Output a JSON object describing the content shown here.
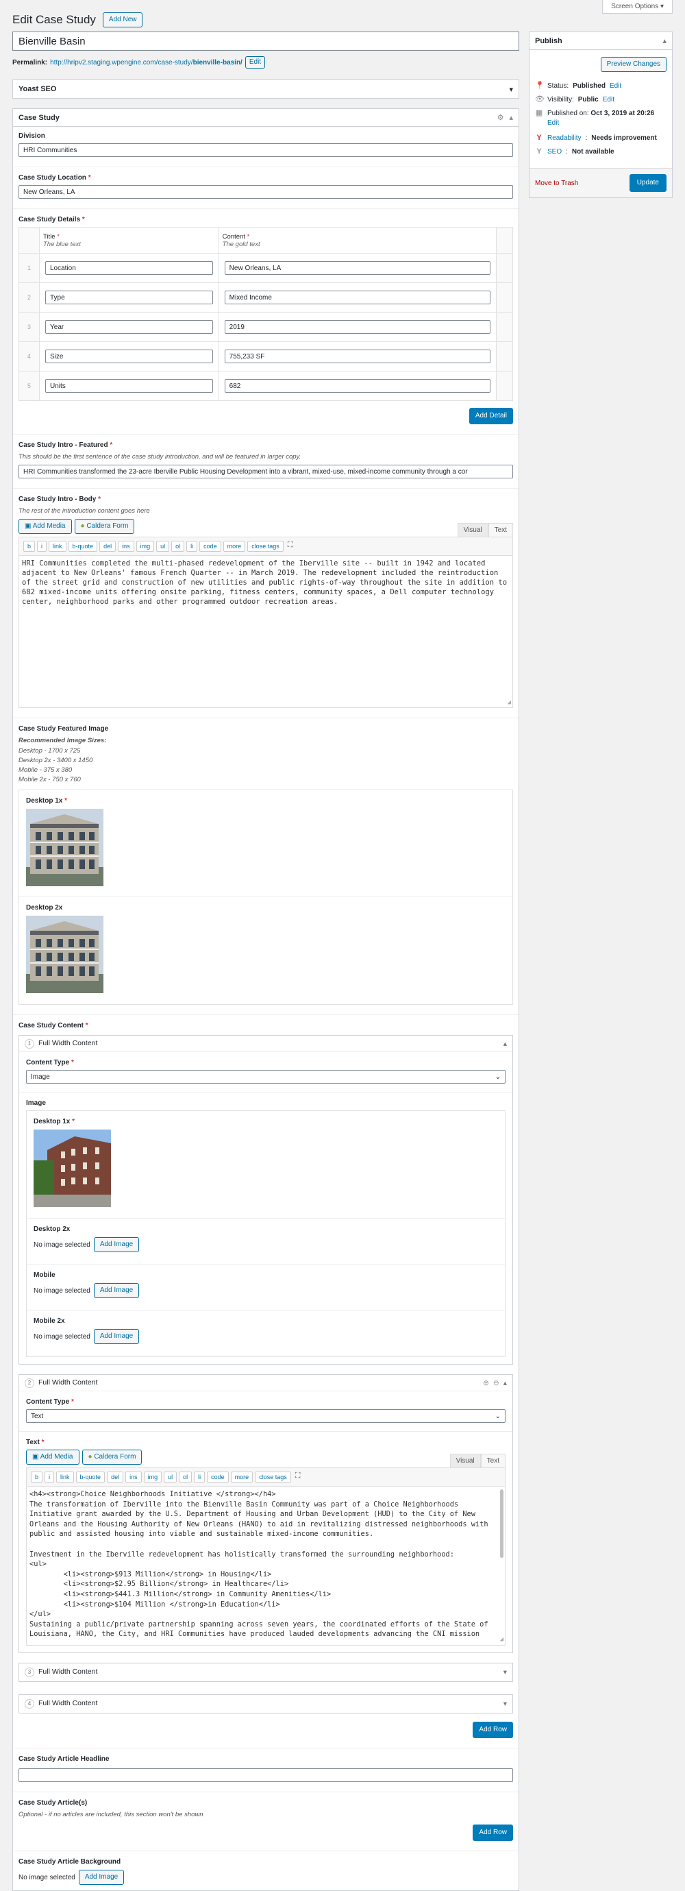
{
  "screen_options": "Screen Options",
  "header": {
    "title": "Edit Case Study",
    "add_new": "Add New"
  },
  "post": {
    "title": "Bienville Basin",
    "permalink_label": "Permalink:",
    "permalink_base": "http://hripv2.staging.wpengine.com/case-study/",
    "permalink_slug": "bienville-basin/",
    "edit_label": "Edit"
  },
  "yoast": {
    "title": "Yoast SEO"
  },
  "case_study": {
    "box_title": "Case Study",
    "division": {
      "label": "Division",
      "value": "HRI Communities"
    },
    "location": {
      "label": "Case Study Location",
      "value": "New Orleans, LA"
    },
    "details": {
      "label": "Case Study Details",
      "col1_title": "Title",
      "col1_sub": "The blue text",
      "col2_title": "Content",
      "col2_sub": "The gold text",
      "rows": [
        {
          "n": "1",
          "title": "Location",
          "content": "New Orleans, LA"
        },
        {
          "n": "2",
          "title": "Type",
          "content": "Mixed Income"
        },
        {
          "n": "3",
          "title": "Year",
          "content": "2019"
        },
        {
          "n": "4",
          "title": "Size",
          "content": "755,233 SF"
        },
        {
          "n": "5",
          "title": "Units",
          "content": "682"
        }
      ],
      "add_button": "Add Detail"
    },
    "intro_featured": {
      "label": "Case Study Intro - Featured",
      "hint": "This should be the first sentence of the case study introduction, and will be featured in larger copy.",
      "value": "HRI Communities transformed the 23-acre Iberville Public Housing Development into a vibrant, mixed-use, mixed-income community through a cor"
    },
    "intro_body": {
      "label": "Case Study Intro - Body",
      "hint": "The rest of the introduction content goes here",
      "add_media": "Add Media",
      "caldera": "Caldera Form",
      "tab_visual": "Visual",
      "tab_text": "Text",
      "quicktags": [
        "b",
        "i",
        "link",
        "b-quote",
        "del",
        "ins",
        "img",
        "ul",
        "ol",
        "li",
        "code",
        "more",
        "close tags"
      ],
      "content": "HRI Communities completed the multi-phased redevelopment of the Iberville site -- built in 1942 and located adjacent to New Orleans' famous French Quarter -- in March 2019. The redevelopment included the reintroduction of the street grid and construction of new utilities and public rights-of-way throughout the site in addition to 682 mixed-income units offering onsite parking, fitness centers, community spaces, a Dell computer technology center, neighborhood parks and other programmed outdoor recreation areas."
    },
    "featured_image": {
      "label": "Case Study Featured Image",
      "sizes_title": "Recommended Image Sizes:",
      "sizes": [
        "Desktop - 1700 x 725",
        "Desktop 2x - 3400 x 1450",
        "Mobile - 375 x 380",
        "Mobile 2x - 750 x 760"
      ],
      "desktop1x": "Desktop 1x",
      "desktop2x": "Desktop 2x"
    },
    "content": {
      "label": "Case Study Content",
      "layout1": {
        "num": "1",
        "title": "Full Width Content",
        "type_label": "Content Type",
        "type_value": "Image",
        "image_label": "Image",
        "desktop1x": "Desktop 1x",
        "desktop2x": "Desktop 2x",
        "mobile": "Mobile",
        "mobile2x": "Mobile 2x",
        "no_image": "No image selected",
        "add_image": "Add Image"
      },
      "layout2": {
        "num": "2",
        "title": "Full Width Content",
        "type_label": "Content Type",
        "type_value": "Text",
        "text_label": "Text",
        "add_media": "Add Media",
        "caldera": "Caldera Form",
        "tab_visual": "Visual",
        "tab_text": "Text",
        "quicktags": [
          "b",
          "i",
          "link",
          "b-quote",
          "del",
          "ins",
          "img",
          "ul",
          "ol",
          "li",
          "code",
          "more",
          "close tags"
        ],
        "lines": [
          "<h4><strong>Choice Neighborhoods Initiative </strong></h4>",
          "The transformation of Iberville into the Bienville Basin Community was part of a Choice Neighborhoods",
          "Initiative grant awarded by the U.S. Department of Housing and Urban Development (HUD) to the City of New",
          "Orleans and the Housing Authority of New Orleans (HANO) to aid in revitalizing distressed neighborhoods with",
          "public and assisted housing into viable and sustainable mixed-income communities.",
          "",
          "Investment in the Iberville redevelopment has holistically transformed the surrounding neighborhood:",
          "<ul>",
          "        <li><strong>$913 Million</strong> in Housing</li>",
          "        <li><strong>$2.95 Billion</strong> in Healthcare</li>",
          "        <li><strong>$441.3 Million</strong> in Community Amenities</li>",
          "        <li><strong>$104 Million </strong>in Education</li>",
          "</ul>",
          "Sustaining a public/private partnership spanning across seven years, the coordinated efforts of the State of",
          "Louisiana, HANO, the City, and HRI Communities have produced lauded developments advancing the CNI mission"
        ]
      },
      "layout3": {
        "num": "3",
        "title": "Full Width Content"
      },
      "layout4": {
        "num": "4",
        "title": "Full Width Content"
      },
      "add_row": "Add Row"
    },
    "article_headline": {
      "label": "Case Study Article Headline",
      "value": ""
    },
    "articles": {
      "label": "Case Study Article(s)",
      "hint": "Optional - if no articles are included, this section won't be shown",
      "add_row": "Add Row"
    },
    "article_bg": {
      "label": "Case Study Article Background",
      "no_image": "No image selected",
      "add_image": "Add Image"
    }
  },
  "publish": {
    "title": "Publish",
    "preview": "Preview Changes",
    "status_label": "Status:",
    "status_value": "Published",
    "status_edit": "Edit",
    "visibility_label": "Visibility:",
    "visibility_value": "Public",
    "visibility_edit": "Edit",
    "published_label": "Published on:",
    "published_value": "Oct 3, 2019 at 20:26",
    "published_edit": "Edit",
    "readability_label": "Readability",
    "readability_value": "Needs improvement",
    "seo_label": "SEO",
    "seo_value": "Not available",
    "trash": "Move to Trash",
    "update": "Update"
  },
  "colors": {
    "accent": "#007cba",
    "required": "#dc3232",
    "link": "#0073aa"
  }
}
